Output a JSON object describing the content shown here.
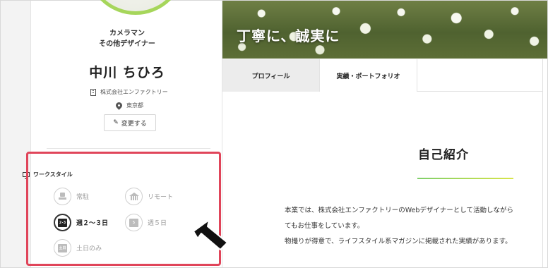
{
  "profile": {
    "job_title_1": "カメラマン",
    "job_title_2": "その他デザイナー",
    "name": "中川 ちひろ",
    "company": "株式会社エンファクトリー",
    "location": "東京都",
    "change_button": "変更する"
  },
  "workstyle": {
    "title": "ワークスタイル",
    "items": [
      {
        "label": "常駐",
        "icon": "chair-icon",
        "active": false
      },
      {
        "label": "リモート",
        "icon": "house-icon",
        "active": false
      },
      {
        "label": "週２～３日",
        "icon": "calendar-icon",
        "glyph": "2-3",
        "active": true
      },
      {
        "label": "週５日",
        "icon": "calendar-icon",
        "glyph": "5",
        "active": false
      },
      {
        "label": "土日のみ",
        "icon": "calendar-icon",
        "glyph": "土日",
        "active": false
      }
    ]
  },
  "hero": {
    "title": "丁寧に、誠実に"
  },
  "tabs": [
    {
      "label": "プロフィール",
      "selected": true
    },
    {
      "label": "実績・ポートフォリオ",
      "selected": false
    }
  ],
  "main": {
    "section_title": "自己紹介",
    "body_lines": [
      "本業では、株式会社エンファクトリーのWebデザイナーとして活動しながら",
      "てもお仕事をしています。",
      "物撮りが得意で、ライフスタイル系マガジンに掲載された実績があります。"
    ]
  },
  "colors": {
    "highlight": "#e0455a",
    "avatar_ring": "#a6d65b",
    "accent_gradient_start": "#7fcf6a",
    "accent_gradient_end": "#d8e54a"
  }
}
